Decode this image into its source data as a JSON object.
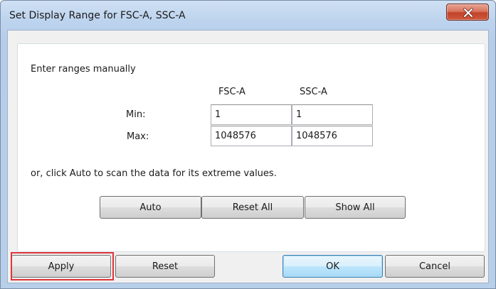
{
  "window": {
    "title": "Set Display Range for FSC-A, SSC-A"
  },
  "group": {
    "instruction": "Enter ranges manually",
    "columns": [
      "FSC-A",
      "SSC-A"
    ],
    "rows": [
      {
        "label": "Min:",
        "fsc": "1",
        "ssc": "1"
      },
      {
        "label": "Max:",
        "fsc": "1048576",
        "ssc": "1048576"
      }
    ],
    "auto_hint": "or, click Auto to scan the data for its extreme values.",
    "buttons": {
      "auto": "Auto",
      "reset_all": "Reset All",
      "show_all": "Show All"
    }
  },
  "footer": {
    "apply": "Apply",
    "reset": "Reset",
    "ok": "OK",
    "cancel": "Cancel"
  },
  "icons": {
    "close": "close-icon"
  },
  "colors": {
    "highlight": "#e0343a",
    "close_button": "#c1432a"
  }
}
